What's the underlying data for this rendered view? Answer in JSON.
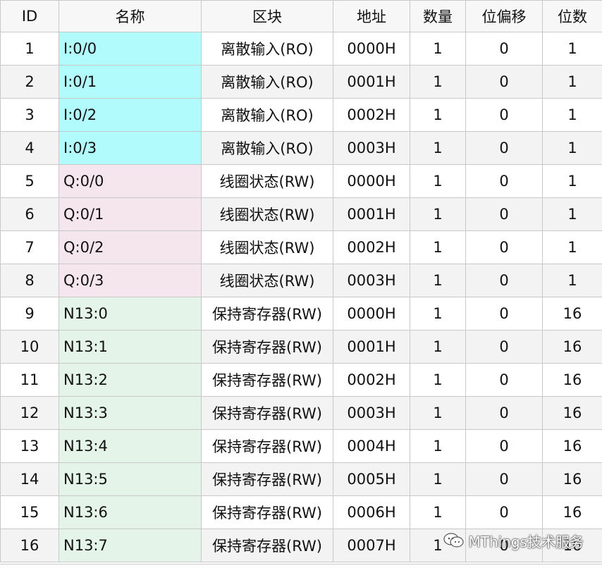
{
  "table": {
    "headers": [
      "ID",
      "名称",
      "区块",
      "地址",
      "数量",
      "位偏移",
      "位数"
    ],
    "rows": [
      {
        "id": "1",
        "name": "I:0/0",
        "block": "离散输入(RO)",
        "address": "0000H",
        "count": "1",
        "bit_offset": "0",
        "bits": "1",
        "category": "ro"
      },
      {
        "id": "2",
        "name": "I:0/1",
        "block": "离散输入(RO)",
        "address": "0001H",
        "count": "1",
        "bit_offset": "0",
        "bits": "1",
        "category": "ro"
      },
      {
        "id": "3",
        "name": "I:0/2",
        "block": "离散输入(RO)",
        "address": "0002H",
        "count": "1",
        "bit_offset": "0",
        "bits": "1",
        "category": "ro"
      },
      {
        "id": "4",
        "name": "I:0/3",
        "block": "离散输入(RO)",
        "address": "0003H",
        "count": "1",
        "bit_offset": "0",
        "bits": "1",
        "category": "ro"
      },
      {
        "id": "5",
        "name": "Q:0/0",
        "block": "线圈状态(RW)",
        "address": "0000H",
        "count": "1",
        "bit_offset": "0",
        "bits": "1",
        "category": "coil"
      },
      {
        "id": "6",
        "name": "Q:0/1",
        "block": "线圈状态(RW)",
        "address": "0001H",
        "count": "1",
        "bit_offset": "0",
        "bits": "1",
        "category": "coil"
      },
      {
        "id": "7",
        "name": "Q:0/2",
        "block": "线圈状态(RW)",
        "address": "0002H",
        "count": "1",
        "bit_offset": "0",
        "bits": "1",
        "category": "coil"
      },
      {
        "id": "8",
        "name": "Q:0/3",
        "block": "线圈状态(RW)",
        "address": "0003H",
        "count": "1",
        "bit_offset": "0",
        "bits": "1",
        "category": "coil"
      },
      {
        "id": "9",
        "name": "N13:0",
        "block": "保持寄存器(RW)",
        "address": "0000H",
        "count": "1",
        "bit_offset": "0",
        "bits": "16",
        "category": "hold"
      },
      {
        "id": "10",
        "name": "N13:1",
        "block": "保持寄存器(RW)",
        "address": "0001H",
        "count": "1",
        "bit_offset": "0",
        "bits": "16",
        "category": "hold"
      },
      {
        "id": "11",
        "name": "N13:2",
        "block": "保持寄存器(RW)",
        "address": "0002H",
        "count": "1",
        "bit_offset": "0",
        "bits": "16",
        "category": "hold"
      },
      {
        "id": "12",
        "name": "N13:3",
        "block": "保持寄存器(RW)",
        "address": "0003H",
        "count": "1",
        "bit_offset": "0",
        "bits": "16",
        "category": "hold"
      },
      {
        "id": "13",
        "name": "N13:4",
        "block": "保持寄存器(RW)",
        "address": "0004H",
        "count": "1",
        "bit_offset": "0",
        "bits": "16",
        "category": "hold"
      },
      {
        "id": "14",
        "name": "N13:5",
        "block": "保持寄存器(RW)",
        "address": "0005H",
        "count": "1",
        "bit_offset": "0",
        "bits": "16",
        "category": "hold"
      },
      {
        "id": "15",
        "name": "N13:6",
        "block": "保持寄存器(RW)",
        "address": "0006H",
        "count": "1",
        "bit_offset": "0",
        "bits": "16",
        "category": "hold"
      },
      {
        "id": "16",
        "name": "N13:7",
        "block": "保持寄存器(RW)",
        "address": "0007H",
        "count": "1",
        "bit_offset": "0",
        "bits": "16",
        "category": "hold"
      }
    ]
  },
  "colors": {
    "ro": "#b2fbfd",
    "coil": "#f5e6ee",
    "hold": "#e4f4e8",
    "grid_line": "#c8c8c8",
    "header_bg": "#f7f7f7",
    "alt_row_bg": "#f3f3f3"
  },
  "watermark": {
    "text": "MThings技术服务",
    "icon": "wechat-icon"
  }
}
